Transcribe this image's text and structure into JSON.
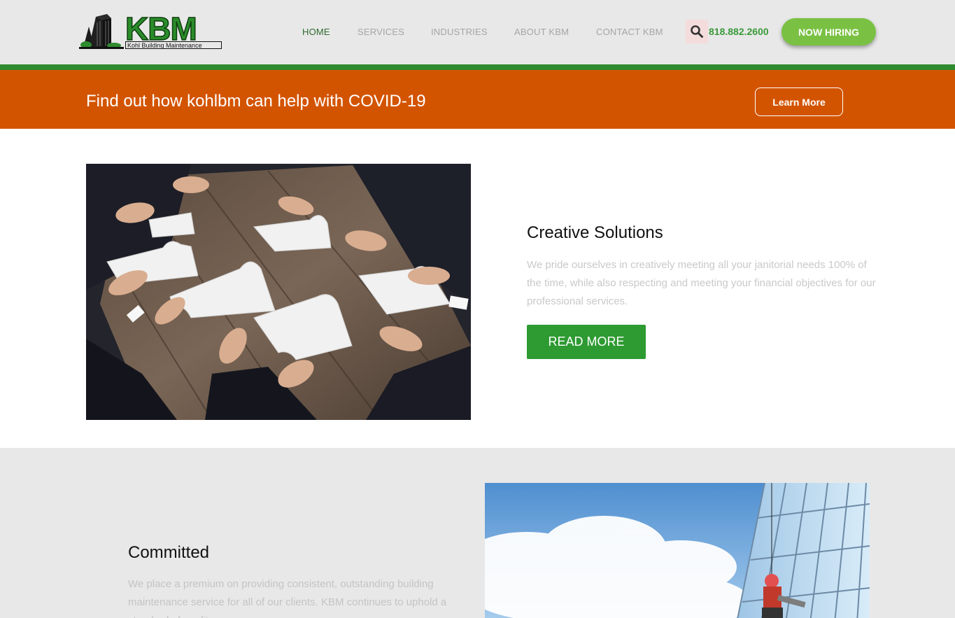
{
  "brand": {
    "name": "KBM",
    "tagline": "Kohl Building Maintenance"
  },
  "nav": {
    "items": [
      {
        "label": "HOME",
        "active": true
      },
      {
        "label": "SERVICES",
        "active": false
      },
      {
        "label": "INDUSTRIES",
        "active": false
      },
      {
        "label": "ABOUT KBM",
        "active": false
      },
      {
        "label": "CONTACT KBM",
        "active": false
      }
    ],
    "search_icon": "search-icon",
    "phone": "818.882.2600",
    "cta_label": "NOW HIRING"
  },
  "banner": {
    "text": "Find out how kohlbm can help with COVID-19",
    "button_label": "Learn More"
  },
  "section_creative": {
    "title": "Creative Solutions",
    "body": "We pride ourselves in creatively meeting all your janitorial needs 100% of the time, while also respecting and meeting your financial objectives for our professional services.",
    "button_label": "READ MORE"
  },
  "section_committed": {
    "title": "Committed",
    "body": "We place a premium on providing consistent, outstanding building maintenance service for all of our clients. KBM continues to uphold a standard of quality"
  },
  "colors": {
    "brand_green": "#2e8b2e",
    "banner_orange": "#d35400",
    "cta_green": "#7ac143",
    "button_green": "#2e9a32"
  }
}
